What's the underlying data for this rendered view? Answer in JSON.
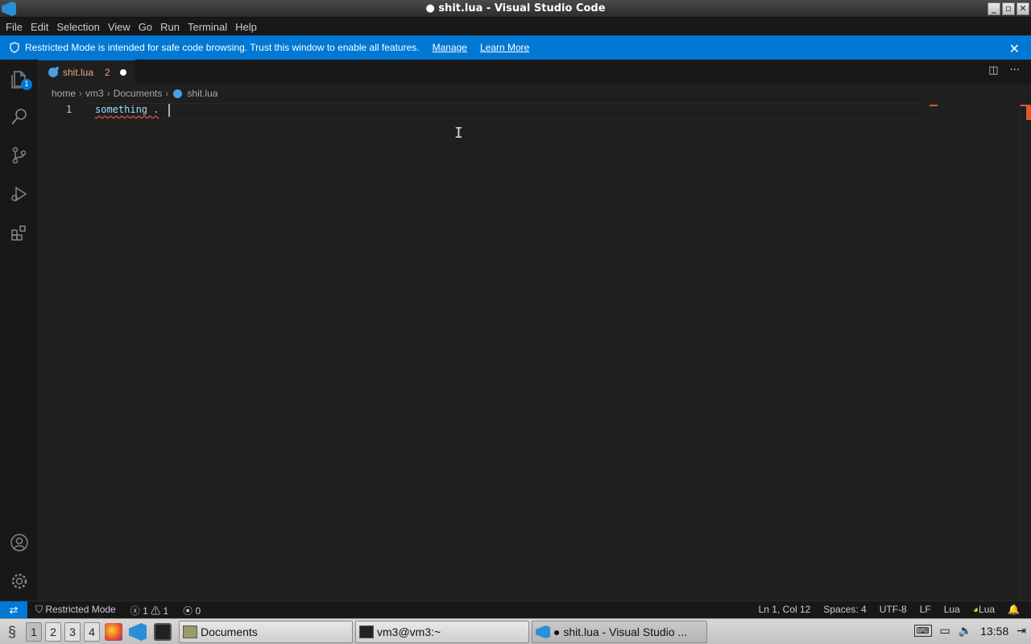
{
  "window": {
    "title": "● shit.lua - Visual Studio Code"
  },
  "menu": [
    "File",
    "Edit",
    "Selection",
    "View",
    "Go",
    "Run",
    "Terminal",
    "Help"
  ],
  "banner": {
    "message": "Restricted Mode is intended for safe code browsing. Trust this window to enable all features.",
    "manage": "Manage",
    "learn_more": "Learn More"
  },
  "activity": {
    "explorer_badge": "1"
  },
  "tab": {
    "filename": "shit.lua",
    "problems": "2"
  },
  "breadcrumb": [
    "home",
    "vm3",
    "Documents",
    "shit.lua"
  ],
  "editor": {
    "line_number": "1",
    "code": "something ."
  },
  "status": {
    "restricted": "Restricted Mode",
    "errors": "1",
    "warnings": "1",
    "ports": "0",
    "position": "Ln 1, Col 12",
    "spaces": "Spaces: 4",
    "encoding": "UTF-8",
    "eol": "LF",
    "language": "Lua",
    "lua_ext": "Lua"
  },
  "taskbar": {
    "workspaces": [
      "1",
      "2",
      "3",
      "4"
    ],
    "tasks": [
      "Documents",
      "vm3@vm3:~",
      "● shit.lua - Visual Studio ..."
    ],
    "clock": "13:58"
  },
  "colors": {
    "accent": "#0078d4",
    "editor_bg": "#1f1f1f",
    "error": "#f14c4c"
  }
}
